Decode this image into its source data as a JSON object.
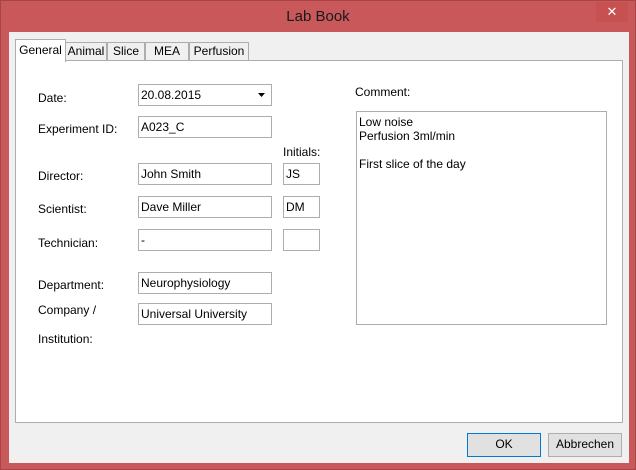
{
  "window": {
    "title": "Lab Book",
    "close_glyph": "✕"
  },
  "tabs": [
    {
      "label": "General",
      "active": true
    },
    {
      "label": "Animal",
      "active": false
    },
    {
      "label": "Slice",
      "active": false
    },
    {
      "label": "MEA",
      "active": false
    },
    {
      "label": "Perfusion",
      "active": false
    }
  ],
  "general": {
    "date_label": "Date:",
    "date_value": "20.08.2015",
    "experiment_id_label": "Experiment ID:",
    "experiment_id_value": "A023_C",
    "initials_label": "Initials:",
    "director_label": "Director:",
    "director_value": "John Smith",
    "director_initials": "JS",
    "scientist_label": "Scientist:",
    "scientist_value": "Dave Miller",
    "scientist_initials": "DM",
    "technician_label": "Technician:",
    "technician_value": "-",
    "technician_initials": "",
    "department_label": "Department:",
    "department_value": "Neurophysiology",
    "company_label_line1": "Company /",
    "company_label_line2": "Institution:",
    "company_value": "Universal University",
    "comment_label": "Comment:",
    "comment_lines": [
      "Low noise",
      "Perfusion 3ml/min",
      "",
      "First slice of the day"
    ]
  },
  "buttons": {
    "ok": "OK",
    "cancel": "Abbrechen"
  },
  "icons": {
    "dropdown": "chevron-down-icon",
    "close": "close-icon"
  },
  "colors": {
    "title_bar": "#c8585a",
    "close_button": "#c75050",
    "default_button_border": "#0078d7"
  }
}
